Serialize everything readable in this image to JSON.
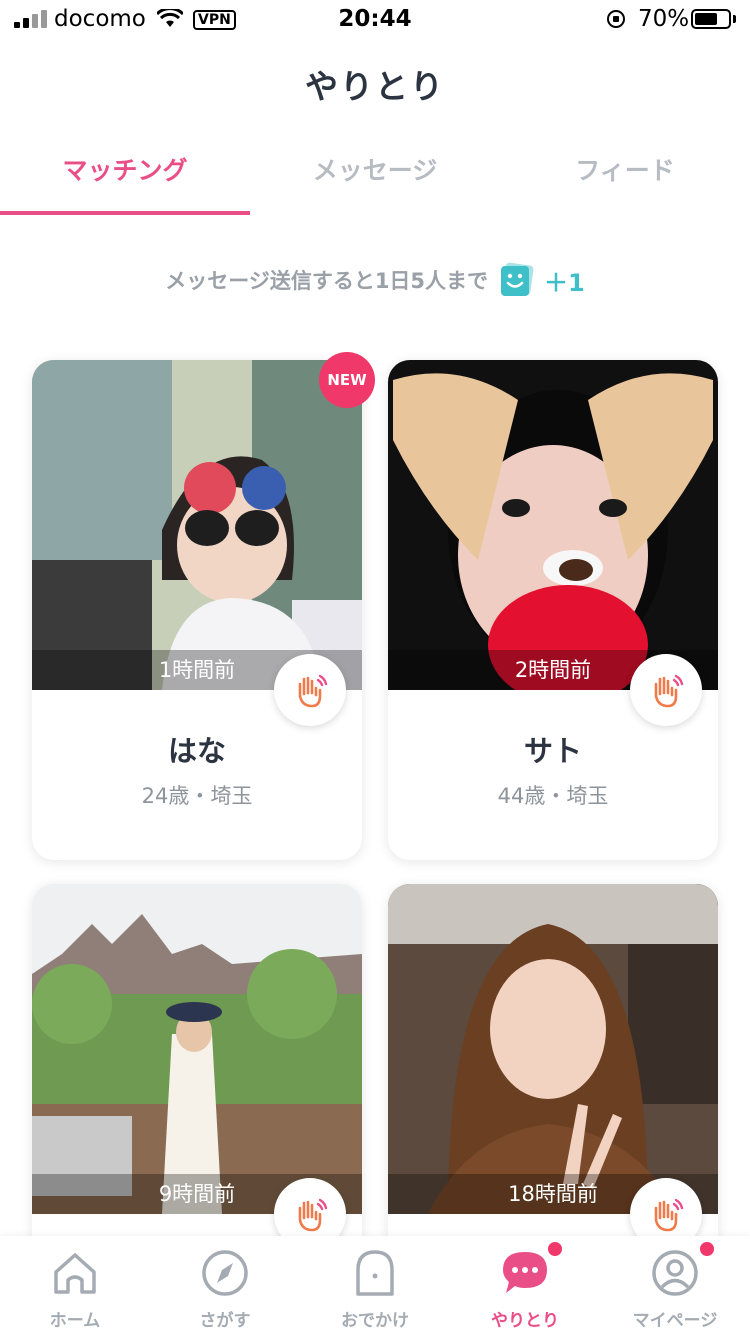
{
  "status_bar": {
    "carrier": "docomo",
    "vpn": "VPN",
    "time": "20:44",
    "battery_percent": "70%",
    "battery_level": 0.7
  },
  "header": {
    "title": "やりとり"
  },
  "tabs": [
    {
      "label": "マッチング",
      "active": true
    },
    {
      "label": "メッセージ",
      "active": false
    },
    {
      "label": "フィード",
      "active": false
    }
  ],
  "notice": {
    "text": "メッセージ送信すると1日5人まで",
    "bonus": "＋1",
    "icon": "smile-ticket-icon"
  },
  "cards": [
    {
      "name": "はな",
      "meta": "24歳・埼玉",
      "time": "1時間前",
      "badge": "NEW"
    },
    {
      "name": "サト",
      "meta": "44歳・埼玉",
      "time": "2時間前"
    },
    {
      "name": "",
      "meta": "",
      "time": "9時間前"
    },
    {
      "name": "",
      "meta": "",
      "time": "18時間前"
    }
  ],
  "tab_bar": [
    {
      "label": "ホーム",
      "icon": "home-icon",
      "active": false
    },
    {
      "label": "さがす",
      "icon": "compass-icon",
      "active": false
    },
    {
      "label": "おでかけ",
      "icon": "ghost-icon",
      "active": false
    },
    {
      "label": "やりとり",
      "icon": "chat-bubble-icon",
      "active": true,
      "badge": true
    },
    {
      "label": "マイページ",
      "icon": "user-icon",
      "active": false,
      "badge": true
    }
  ],
  "colors": {
    "accent": "#ea4e86",
    "badge": "#f0386a",
    "teal": "#3fbfc7"
  }
}
